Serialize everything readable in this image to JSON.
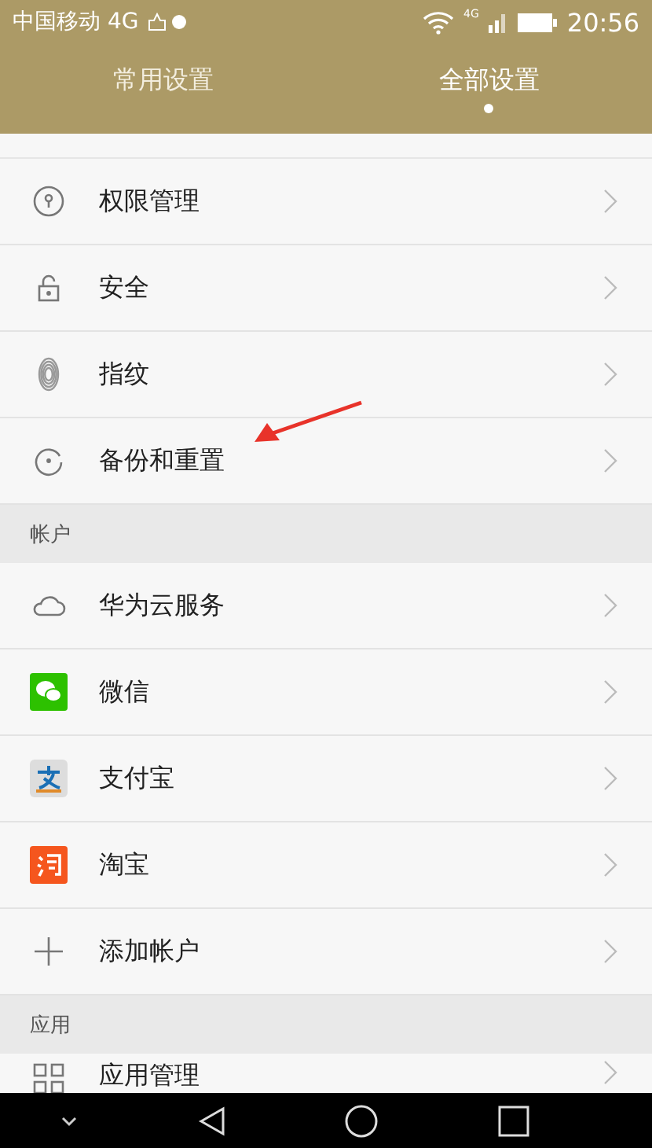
{
  "status_bar": {
    "carrier": "中国移动 4G",
    "network_badge": "4G",
    "time": "20:56"
  },
  "tabs": [
    {
      "label": "常用设置",
      "selected": false
    },
    {
      "label": "全部设置",
      "selected": true
    }
  ],
  "sections": [
    {
      "items": [
        {
          "label": "权限管理"
        },
        {
          "label": "安全"
        },
        {
          "label": "指纹"
        },
        {
          "label": "备份和重置"
        }
      ]
    },
    {
      "header": "帐户",
      "items": [
        {
          "label": "华为云服务"
        },
        {
          "label": "微信"
        },
        {
          "label": "支付宝"
        },
        {
          "label": "淘宝"
        },
        {
          "label": "添加帐户"
        }
      ]
    },
    {
      "header": "应用",
      "items": [
        {
          "label": "应用管理"
        }
      ]
    }
  ]
}
